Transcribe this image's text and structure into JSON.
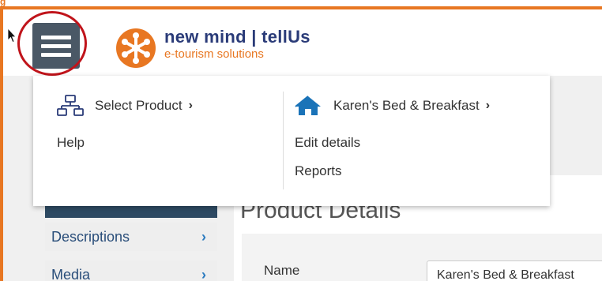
{
  "caption": "g",
  "header": {
    "logo_name": "new mind | tellUs",
    "logo_tagline": "e-tourism solutions"
  },
  "menu": {
    "select_product": "Select Product",
    "chevron": "›",
    "help": "Help",
    "property_name": "Karen's Bed & Breakfast",
    "edit_details": "Edit details",
    "reports": "Reports"
  },
  "sidebar": {
    "items": [
      {
        "label": "Descriptions",
        "chevron": "›"
      },
      {
        "label": "Media",
        "chevron": "›"
      }
    ]
  },
  "main": {
    "title": "Product Details",
    "name_label": "Name",
    "name_value": "Karen's Bed & Breakfast"
  },
  "colors": {
    "accent_orange": "#e87722",
    "brand_navy": "#2a3b78",
    "annotation_red": "#c0141b",
    "hamburger_bg": "#4a5866",
    "home_icon_blue": "#1a73b8"
  },
  "icons": {
    "hamburger": "hamburger-menu-icon",
    "sitemap": "sitemap-icon",
    "home": "home-icon",
    "cursor": "mouse-pointer-icon"
  }
}
